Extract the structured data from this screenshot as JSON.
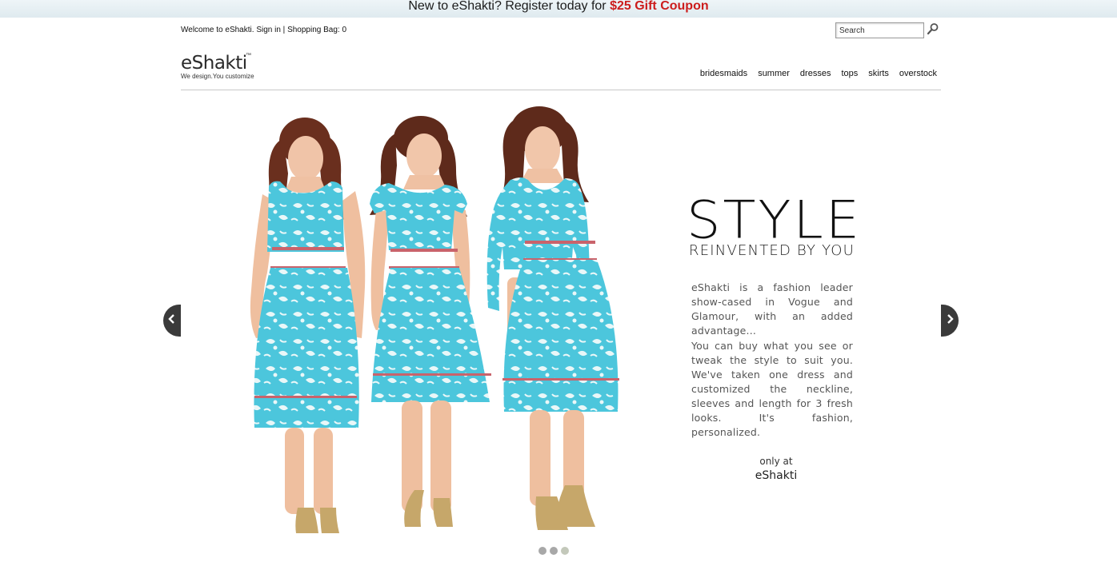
{
  "promo": {
    "text": "New to eShakti? Register today for ",
    "coupon": "$25 Gift Coupon"
  },
  "utility": {
    "welcome": "Welcome to eShakti.",
    "sign_in": "Sign in",
    "separator": "|",
    "bag": "Shopping Bag: 0"
  },
  "search": {
    "placeholder": "Search",
    "value": "Search",
    "icon": "search-icon"
  },
  "logo": {
    "word": "eShakti",
    "tm": "™",
    "tagline": "We design.You customize"
  },
  "nav": {
    "items": [
      "bridesmaids",
      "summer",
      "dresses",
      "tops",
      "skirts",
      "overstock"
    ]
  },
  "hero": {
    "headline": "STYLE",
    "subhead": "REINVENTED BY YOU",
    "paragraph1": "eShakti is a fashion leader show-cased in Vogue and Glamour, with an added advantage...",
    "paragraph2": "You can buy what you see or tweak the style to suit you. We've taken one dress and customized the neckline, sleeves and length for 3 fresh looks. It's fashion, personalized.",
    "only_at": "only at",
    "brand": "eShakti",
    "dress_color": "#4cc6dc",
    "prev_icon": "chevron-left-icon",
    "next_icon": "chevron-right-icon"
  },
  "pager": {
    "slides": 3,
    "active": 3
  },
  "colors": {
    "coupon": "#cc1d1d",
    "arrow": "#3a3a3a",
    "dress": "#4cc6dc"
  }
}
